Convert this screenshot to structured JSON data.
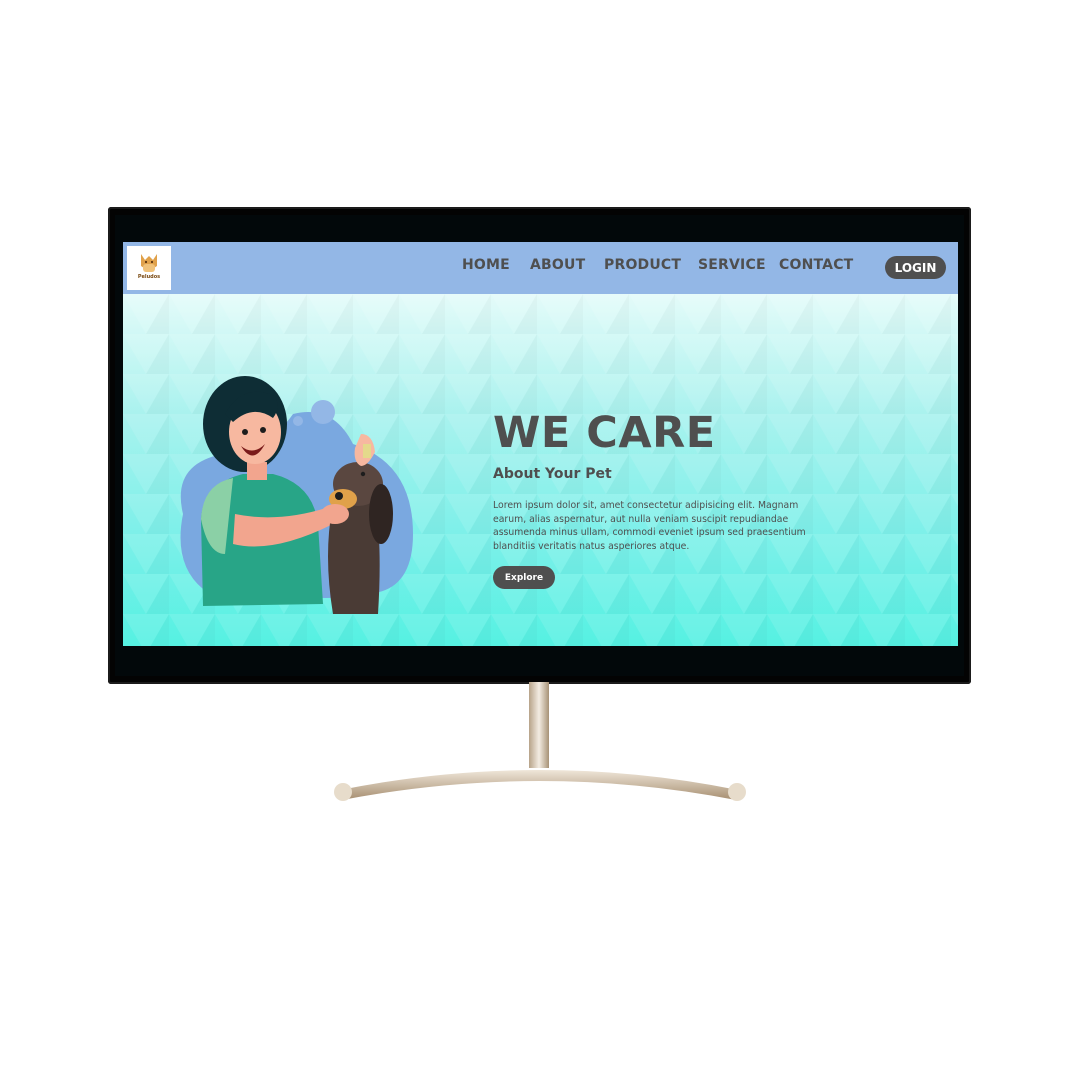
{
  "site": {
    "logo": {
      "text": "Peludos"
    },
    "nav": {
      "items": [
        {
          "label": "HOME"
        },
        {
          "label": "ABOUT"
        },
        {
          "label": "PRODUCT"
        },
        {
          "label": "SERVICE"
        },
        {
          "label": "CONTACT"
        }
      ],
      "login_label": "LOGIN"
    },
    "hero": {
      "title": "WE CARE",
      "subtitle": "About Your Pet",
      "body": "Lorem ipsum dolor sit, amet consectetur adipisicing elit. Magnam earum, alias aspernatur, aut nulla veniam suscipit repudiandae assumenda minus ullam, commodi eveniet ipsum sed praesentium blanditiis veritatis natus asperiores atque.",
      "cta_label": "Explore",
      "illustration": "woman-cleaning-dog-ears-illustration"
    }
  },
  "colors": {
    "nav_bg": "#93b7e6",
    "hero_top": "#e4fbf9",
    "hero_bottom": "#55f1e2",
    "text_dark": "#4f4f4f",
    "button_bg": "#4f4f4f",
    "button_text": "#ffffff",
    "monitor_frame": "#030303"
  }
}
